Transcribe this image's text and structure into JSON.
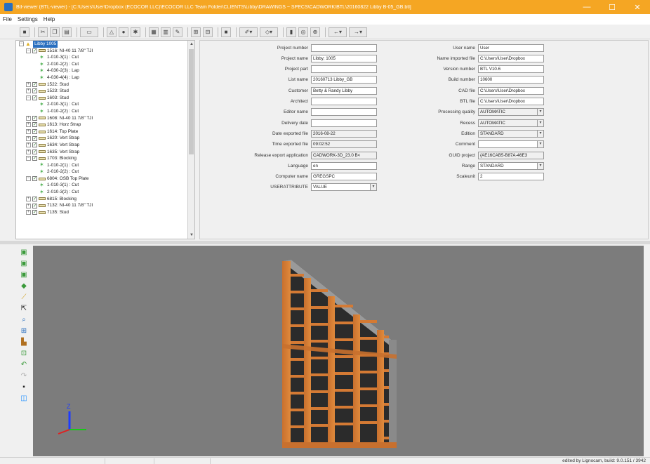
{
  "window": {
    "title": "Btl-viewer (BTL-viewer) - [C:\\Users\\User\\Dropbox (ECOCOR LLC)\\ECOCOR LLC Team Folder\\CLIENTS\\Libby\\DRAWINGS ~ SPECS\\CADWORK\\BTL\\20160822 Libby B-05_GB.btl]",
    "minimize": "—",
    "maximize": "☐",
    "close": "✕"
  },
  "menu": [
    "File",
    "Settings",
    "Help"
  ],
  "tree": [
    {
      "level": 0,
      "type": "root",
      "exp": "−",
      "label": "Libby 1005",
      "selected": true
    },
    {
      "level": 1,
      "type": "part",
      "exp": "−",
      "label": "1516: NI-40 11 7/8\" TJI"
    },
    {
      "level": 2,
      "type": "leaf",
      "label": "1-010-3(1) : Cut"
    },
    {
      "level": 2,
      "type": "leaf",
      "label": "2-010-2(2) : Cut"
    },
    {
      "level": 2,
      "type": "leaf",
      "label": "4-030-2(3) : Lap"
    },
    {
      "level": 2,
      "type": "leaf",
      "label": "4-030-4(4) : Lap"
    },
    {
      "level": 1,
      "type": "part",
      "exp": "+",
      "label": "1522: Stud"
    },
    {
      "level": 1,
      "type": "part",
      "exp": "+",
      "label": "1523: Stud"
    },
    {
      "level": 1,
      "type": "part",
      "exp": "−",
      "label": "1603: Stud"
    },
    {
      "level": 2,
      "type": "leaf",
      "label": "2-010-3(1) : Cut"
    },
    {
      "level": 2,
      "type": "leaf",
      "label": "1-010-2(2) : Cut"
    },
    {
      "level": 1,
      "type": "part",
      "exp": "+",
      "label": "1608: NI-40 11 7/8\" TJI"
    },
    {
      "level": 1,
      "type": "part",
      "exp": "+",
      "label": "1613: Horz Strap"
    },
    {
      "level": 1,
      "type": "part",
      "exp": "+",
      "label": "1614: Top Plate"
    },
    {
      "level": 1,
      "type": "part",
      "exp": "+",
      "label": "1620: Vert Strap"
    },
    {
      "level": 1,
      "type": "part",
      "exp": "+",
      "label": "1634: Vert Strap"
    },
    {
      "level": 1,
      "type": "part",
      "exp": "+",
      "label": "1635: Vert Strap"
    },
    {
      "level": 1,
      "type": "part",
      "exp": "−",
      "label": "1703: Blocking"
    },
    {
      "level": 2,
      "type": "leaf",
      "label": "1-010-2(1) : Cut"
    },
    {
      "level": 2,
      "type": "leaf",
      "label": "2-010-2(2) : Cut"
    },
    {
      "level": 1,
      "type": "part",
      "exp": "−",
      "label": "6804: OSB Top Plate"
    },
    {
      "level": 2,
      "type": "leaf",
      "label": "1-010-3(1) : Cut"
    },
    {
      "level": 2,
      "type": "leaf",
      "label": "2-010-3(2) : Cut"
    },
    {
      "level": 1,
      "type": "part",
      "exp": "+",
      "label": "6815: Blocking"
    },
    {
      "level": 1,
      "type": "part",
      "exp": "+",
      "label": "7132: NI-40 11 7/8\" TJI"
    },
    {
      "level": 1,
      "type": "part",
      "exp": "+",
      "label": "7135: Stud"
    }
  ],
  "props_left": [
    {
      "label": "Project number",
      "value": ""
    },
    {
      "label": "Project name",
      "value": "Libby; 1005"
    },
    {
      "label": "Project part",
      "value": ""
    },
    {
      "label": "List name",
      "value": "20160713 Libby_GB"
    },
    {
      "label": "Customer",
      "value": "Betty & Randy Libby"
    },
    {
      "label": "Architect",
      "value": ""
    },
    {
      "label": "Editor name",
      "value": ""
    },
    {
      "label": "Delivery date",
      "value": ""
    },
    {
      "label": "Date exported file",
      "value": "2016-08-22",
      "ro": true
    },
    {
      "label": "Time exported file",
      "value": "09:02:52",
      "ro": true
    },
    {
      "label": "Release export application",
      "value": "CADWORK-3D_23.0 B<",
      "ro": true
    },
    {
      "label": "Language",
      "value": "en"
    },
    {
      "label": "Computer name",
      "value": "GREGSPC"
    },
    {
      "label": "USERATTRIBUTE",
      "value": "VALUE",
      "dd": true
    }
  ],
  "props_right": [
    {
      "label": "User name",
      "value": "User"
    },
    {
      "label": "Name imported file",
      "value": "C:\\Users\\User\\Dropbox"
    },
    {
      "label": "Version number",
      "value": "BTL V10.6"
    },
    {
      "label": "Build number",
      "value": "10600"
    },
    {
      "label": "CAD file",
      "value": "C:\\Users\\User\\Dropbox"
    },
    {
      "label": "BTL file",
      "value": "C:\\Users\\User\\Dropbox"
    },
    {
      "label": "Processing quality",
      "value": "AUTOMATIC",
      "ro": true,
      "dd": true
    },
    {
      "label": "Recess",
      "value": "AUTOMATIC",
      "ro": true,
      "dd": true
    },
    {
      "label": "Edition",
      "value": "STANDARD",
      "ro": true,
      "dd": true
    },
    {
      "label": "Comment",
      "value": "",
      "dd": true
    },
    {
      "label": "GUID project",
      "value": "{AE16CAB5-B87A-46E3",
      "ro": true
    },
    {
      "label": "Range",
      "value": "STANDARD",
      "dd": true
    },
    {
      "label": "Scaleunit",
      "value": "2"
    }
  ],
  "axes": {
    "z": "Z"
  },
  "status": {
    "text": "edited by Lignocam, build: 9.0.151 / 3942"
  }
}
